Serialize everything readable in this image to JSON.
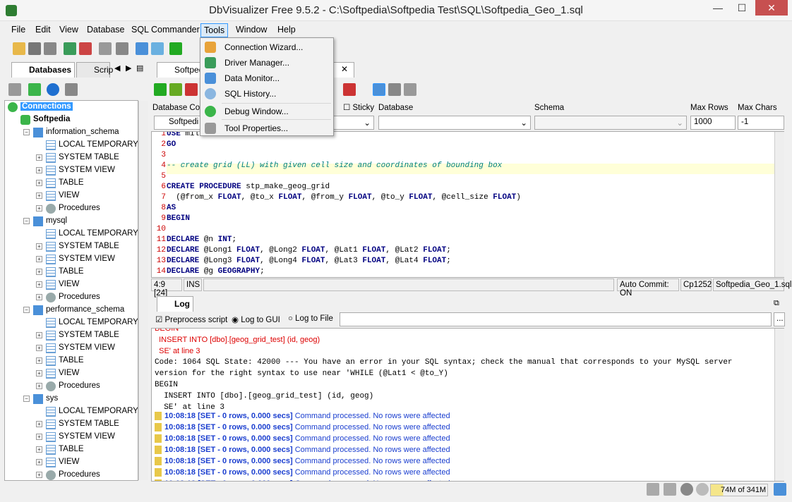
{
  "window": {
    "title": "DbVisualizer Free 9.5.2 - C:\\Softpedia\\Softpedia Test\\SQL\\Softpedia_Geo_1.sql",
    "minimize": "—",
    "maximize": "☐",
    "close": "✕"
  },
  "menu": [
    "File",
    "Edit",
    "View",
    "Database",
    "SQL Commander",
    "Tools",
    "Window",
    "Help"
  ],
  "tools_menu": [
    "Connection Wizard...",
    "Driver Manager...",
    "Data Monitor...",
    "SQL History...",
    "Debug Window...",
    "Tool Properties..."
  ],
  "left_tabs": [
    "Databases",
    "Scrip"
  ],
  "editor_tab": "Softped",
  "tree": {
    "root": "Connections",
    "conn": "Softpedia",
    "schemas": [
      {
        "name": "information_schema",
        "items": [
          "LOCAL TEMPORARY",
          "SYSTEM TABLE",
          "SYSTEM VIEW",
          "TABLE",
          "VIEW",
          "Procedures"
        ]
      },
      {
        "name": "mysql",
        "items": [
          "LOCAL TEMPORARY",
          "SYSTEM TABLE",
          "SYSTEM VIEW",
          "TABLE",
          "VIEW",
          "Procedures"
        ]
      },
      {
        "name": "performance_schema",
        "items": [
          "LOCAL TEMPORARY",
          "SYSTEM TABLE",
          "SYSTEM VIEW",
          "TABLE",
          "VIEW",
          "Procedures"
        ]
      },
      {
        "name": "sys",
        "items": [
          "LOCAL TEMPORARY",
          "SYSTEM TABLE",
          "SYSTEM VIEW",
          "TABLE",
          "VIEW",
          "Procedures"
        ]
      }
    ]
  },
  "conn_bar": {
    "db_conn_label": "Database Con",
    "sticky": "Sticky",
    "database": "Database",
    "schema": "Schema",
    "max_rows": "Max Rows",
    "max_chars": "Max Chars",
    "conn_value": "Softpedi",
    "max_rows_value": "1000",
    "max_chars_value": "-1"
  },
  "code": [
    {
      "n": "1",
      "t": "USE milano"
    },
    {
      "n": "2",
      "t": "GO"
    },
    {
      "n": "3",
      "t": ""
    },
    {
      "n": "4",
      "t": "-- create grid (LL) with given cell size and coordinates of bounding box"
    },
    {
      "n": "5",
      "t": ""
    },
    {
      "n": "6",
      "t": "CREATE PROCEDURE stp_make_geog_grid"
    },
    {
      "n": "7",
      "t": "  (@from_x FLOAT, @to_x FLOAT, @from_y FLOAT, @to_y FLOAT, @cell_size FLOAT)"
    },
    {
      "n": "8",
      "t": "AS"
    },
    {
      "n": "9",
      "t": "BEGIN"
    },
    {
      "n": "10",
      "t": ""
    },
    {
      "n": "11",
      "t": "DECLARE @n INT;"
    },
    {
      "n": "12",
      "t": "DECLARE @Long1 FLOAT, @Long2 FLOAT, @Lat1 FLOAT, @Lat2 FLOAT;"
    },
    {
      "n": "13",
      "t": "DECLARE @Long3 FLOAT, @Long4 FLOAT, @Lat3 FLOAT, @Lat4 FLOAT;"
    },
    {
      "n": "14",
      "t": "DECLARE @g GEOGRAPHY;"
    }
  ],
  "status": {
    "pos": "4:9 [24]",
    "mode": "INS",
    "autocommit": "Auto Commit: ON",
    "charset": "Cp1252",
    "file": "Softpedia_Geo_1.sql"
  },
  "log_tab": "Log",
  "log_opts": {
    "preprocess": "Preprocess script",
    "gui": "Log to GUI",
    "file": "Log to File",
    "browse": "..."
  },
  "log_lines": [
    {
      "c": "err",
      "t": "BEGIN"
    },
    {
      "c": "err",
      "t": "  INSERT INTO [dbo].[geog_grid_test] (id, geog)"
    },
    {
      "c": "err",
      "t": "  SE' at line 3"
    },
    {
      "c": "mono",
      "t": "Code: 1064 SQL State: 42000 --- You have an error in your SQL syntax; check the manual that corresponds to your MySQL server"
    },
    {
      "c": "mono",
      "t": "version for the right syntax to use near 'WHILE (@Lat1 < @to_Y)"
    },
    {
      "c": "mono",
      "t": "BEGIN"
    },
    {
      "c": "mono",
      "t": "  INSERT INTO [dbo].[geog_grid_test] (id, geog)"
    },
    {
      "c": "mono",
      "t": "  SE' at line 3"
    }
  ],
  "log_ok": {
    "time": "10:08:18",
    "stat": "[SET - 0 rows, 0.000 secs]",
    "msg": "Command processed. No rows were affected"
  },
  "memory": "74M of 341M"
}
